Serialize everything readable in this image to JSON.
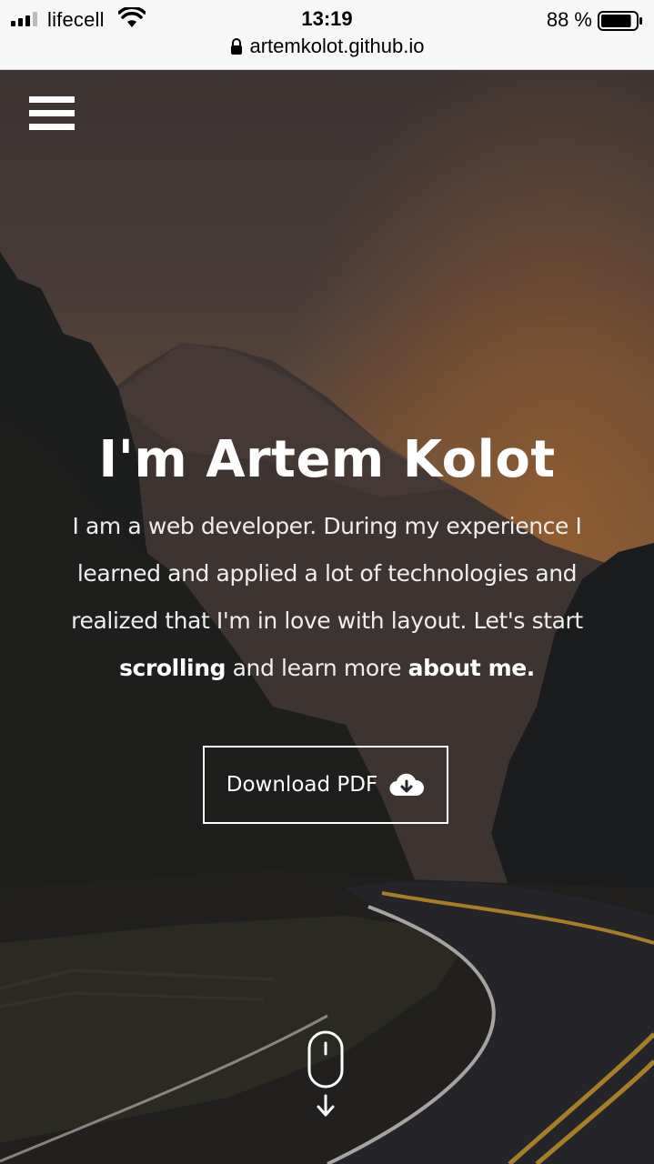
{
  "status_bar": {
    "carrier": "lifecell",
    "time": "13:19",
    "battery": "88 %",
    "battery_level": 0.88,
    "url": "artemkolot.github.io"
  },
  "hero": {
    "title": "I'm Artem Kolot",
    "intro_part1": "I am a web developer. During my experience I learned and applied a lot of technologies and realized that I'm in love with layout. Let's start ",
    "intro_bold1": "scrolling",
    "intro_part2": " and learn more ",
    "intro_bold2": "about me.",
    "download_label": "Download PDF"
  },
  "icons": {
    "menu": "hamburger-menu-icon",
    "download": "cloud-download-icon",
    "scroll": "mouse-scroll-icon"
  },
  "colors": {
    "text": "#ffffff",
    "road_line": "#d9a32b",
    "sky_glow": "#b0703a"
  }
}
